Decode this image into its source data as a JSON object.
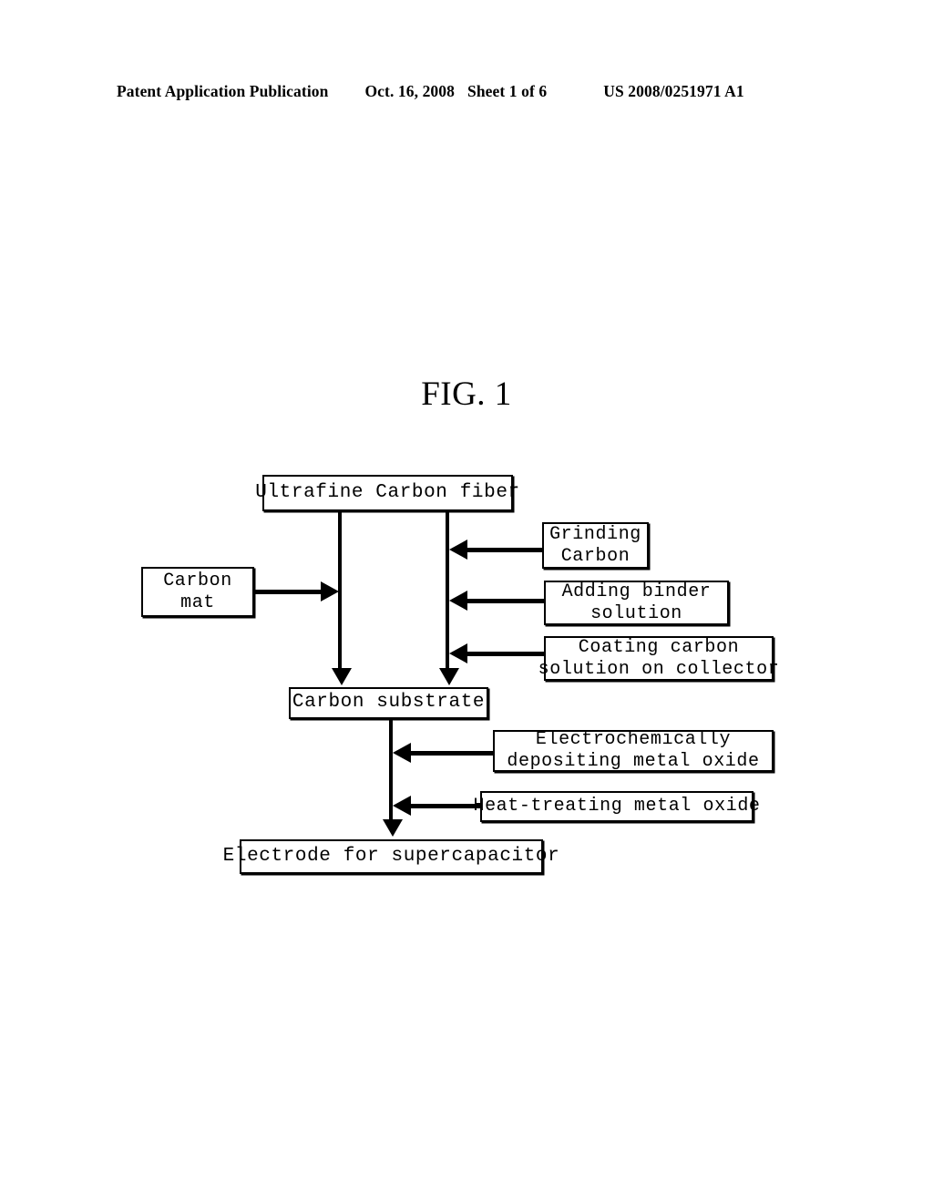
{
  "header": {
    "publication": "Patent Application Publication",
    "date": "Oct. 16, 2008",
    "sheet": "Sheet 1 of 6",
    "patent_number": "US 2008/0251971 A1"
  },
  "figure": {
    "title": "FIG. 1"
  },
  "diagram": {
    "type": "flowchart",
    "nodes": [
      {
        "id": "ultrafine",
        "lines": [
          "Ultrafine Carbon fiber"
        ]
      },
      {
        "id": "grinding",
        "lines": [
          "Grinding",
          "Carbon"
        ]
      },
      {
        "id": "carbon_mat",
        "lines": [
          "Carbon",
          "mat"
        ]
      },
      {
        "id": "binder",
        "lines": [
          "Adding binder",
          "solution"
        ]
      },
      {
        "id": "coating",
        "lines": [
          "Coating carbon",
          "solution on collector"
        ]
      },
      {
        "id": "substrate",
        "lines": [
          "Carbon substrate"
        ]
      },
      {
        "id": "echem",
        "lines": [
          "Electrochemically",
          "depositing metal oxide"
        ]
      },
      {
        "id": "heat",
        "lines": [
          "Heat-treating metal oxide"
        ]
      },
      {
        "id": "electrode",
        "lines": [
          "Electrode for supercapacitor"
        ]
      }
    ],
    "edges": [
      {
        "from": "ultrafine",
        "to": "substrate",
        "direction": "down"
      },
      {
        "from": "ultrafine",
        "to": "substrate",
        "direction": "down"
      },
      {
        "from": "carbon_mat",
        "to": "substrate",
        "direction": "right"
      },
      {
        "from": "grinding",
        "to": "substrate",
        "direction": "left"
      },
      {
        "from": "binder",
        "to": "substrate",
        "direction": "left"
      },
      {
        "from": "coating",
        "to": "substrate",
        "direction": "left"
      },
      {
        "from": "substrate",
        "to": "electrode",
        "direction": "down"
      },
      {
        "from": "echem",
        "to": "electrode",
        "direction": "left"
      },
      {
        "from": "heat",
        "to": "electrode",
        "direction": "left"
      }
    ],
    "colors": {
      "stroke": "#000000",
      "fill": "#ffffff"
    }
  }
}
